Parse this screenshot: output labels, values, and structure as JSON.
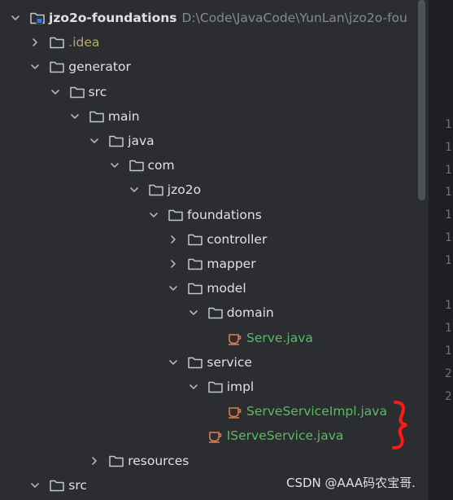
{
  "project": {
    "name": "jzo2o-foundations",
    "path": "D:\\Code\\JavaCode\\YunLan\\jzo2o-fou"
  },
  "tree": [
    {
      "label": "jzo2o-foundations",
      "kind": "project",
      "depth": 0,
      "expanded": true
    },
    {
      "label": ".idea",
      "kind": "folder-ignored",
      "depth": 1,
      "expanded": false
    },
    {
      "label": "generator",
      "kind": "folder",
      "depth": 1,
      "expanded": true
    },
    {
      "label": "src",
      "kind": "folder",
      "depth": 2,
      "expanded": true
    },
    {
      "label": "main",
      "kind": "folder",
      "depth": 3,
      "expanded": true
    },
    {
      "label": "java",
      "kind": "folder",
      "depth": 4,
      "expanded": true
    },
    {
      "label": "com",
      "kind": "folder",
      "depth": 5,
      "expanded": true
    },
    {
      "label": "jzo2o",
      "kind": "folder",
      "depth": 6,
      "expanded": true
    },
    {
      "label": "foundations",
      "kind": "folder",
      "depth": 7,
      "expanded": true
    },
    {
      "label": "controller",
      "kind": "folder",
      "depth": 8,
      "expanded": false
    },
    {
      "label": "mapper",
      "kind": "folder",
      "depth": 8,
      "expanded": false
    },
    {
      "label": "model",
      "kind": "folder",
      "depth": 8,
      "expanded": true
    },
    {
      "label": "domain",
      "kind": "folder",
      "depth": 9,
      "expanded": true
    },
    {
      "label": "Serve.java",
      "kind": "java",
      "depth": 10
    },
    {
      "label": "service",
      "kind": "folder",
      "depth": 8,
      "expanded": true
    },
    {
      "label": "impl",
      "kind": "folder",
      "depth": 9,
      "expanded": true
    },
    {
      "label": "ServeServiceImpl.java",
      "kind": "java",
      "depth": 10
    },
    {
      "label": "IServeService.java",
      "kind": "java",
      "depth": 9
    },
    {
      "label": "resources",
      "kind": "folder",
      "depth": 4,
      "expanded": false
    },
    {
      "label": "src",
      "kind": "folder",
      "depth": 1,
      "expanded": true
    }
  ],
  "gutter_numbers": [
    "1",
    "1",
    "1",
    "1",
    "1",
    "1",
    "1",
    "",
    "1",
    "1",
    "1",
    "2",
    "2"
  ],
  "watermark": "CSDN @AAA码农宝哥.",
  "colors": {
    "background": "#2b2d30",
    "text": "#dfe1e5",
    "path_text": "#868a91",
    "ignored_text": "#b3ae60",
    "java_text": "#5fb865",
    "java_icon": "#e08050",
    "annotation": "#ff1a1a"
  }
}
